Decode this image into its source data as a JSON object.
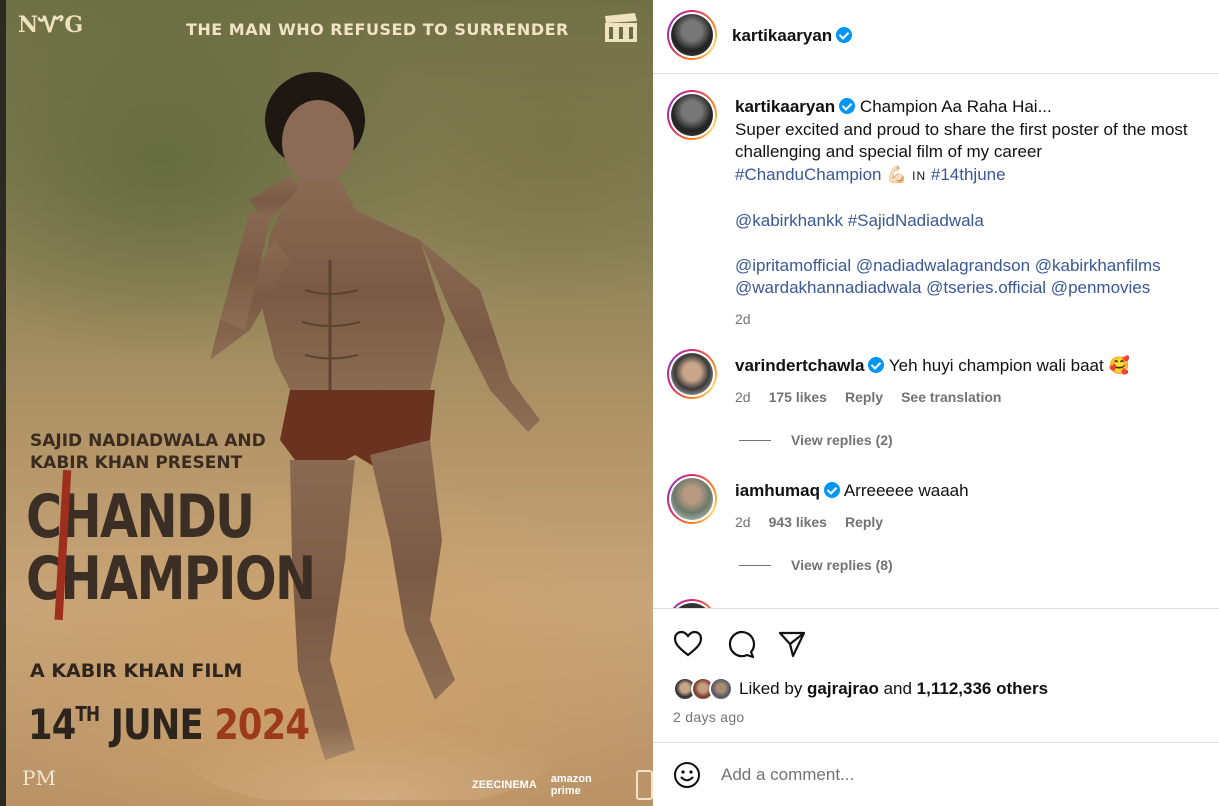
{
  "poster": {
    "brand_mark": "NᏉG",
    "tagline": "THE MAN WHO REFUSED TO SURRENDER",
    "presenters": "SAJID NADIADWALA AND\nKABIR KHAN PRESENT",
    "title_line1": "CHANDU",
    "title_line2": "CHAMPION",
    "film_by": "A KABIR KHAN FILM",
    "date_day": "14",
    "date_suffix": "TH",
    "date_month": " JUNE ",
    "date_year": "2024",
    "pm_logo": "PM",
    "partner_1": "ZEECINEMA",
    "partner_2": "amazon prime"
  },
  "header": {
    "username": "kartikaaryan"
  },
  "caption": {
    "username": "kartikaaryan",
    "line1": "Champion Aa Raha Hai...",
    "line2": "Super excited and proud to share the first poster of the most challenging and special film of my career",
    "hashtag_1": "#ChanduChampion",
    "emoji": "💪🏻",
    "in_text": "IN",
    "hashtag_2": "#14thjune",
    "mentions_1": "@kabirkhankk #SajidNadiadwala",
    "mentions_2": "@ipritamofficial @nadiadwalagrandson @kabirkhanfilms @wardakhannadiadwala @tseries.official @penmovies",
    "time": "2d"
  },
  "comments": [
    {
      "username": "varindertchawla",
      "text": "Yeh huyi champion wali baat 🥰",
      "time": "2d",
      "likes": "175 likes",
      "reply": "Reply",
      "translate": "See translation",
      "view_replies": "View replies (2)"
    },
    {
      "username": "iamhumaq",
      "text": "Arreeeee waaah",
      "time": "2d",
      "likes": "943 likes",
      "reply": "Reply",
      "view_replies": "View replies (8)"
    }
  ],
  "actions": {
    "liked_by_prefix": "Liked by ",
    "liked_by_user": "gajrajrao",
    "liked_by_and": " and ",
    "liked_by_count": "1,112,336 others",
    "time_ago": "2 days ago"
  },
  "add_comment": {
    "placeholder": "Add a comment..."
  },
  "colors": {
    "verified": "#0095f6",
    "link": "#385898",
    "muted": "#737373"
  }
}
